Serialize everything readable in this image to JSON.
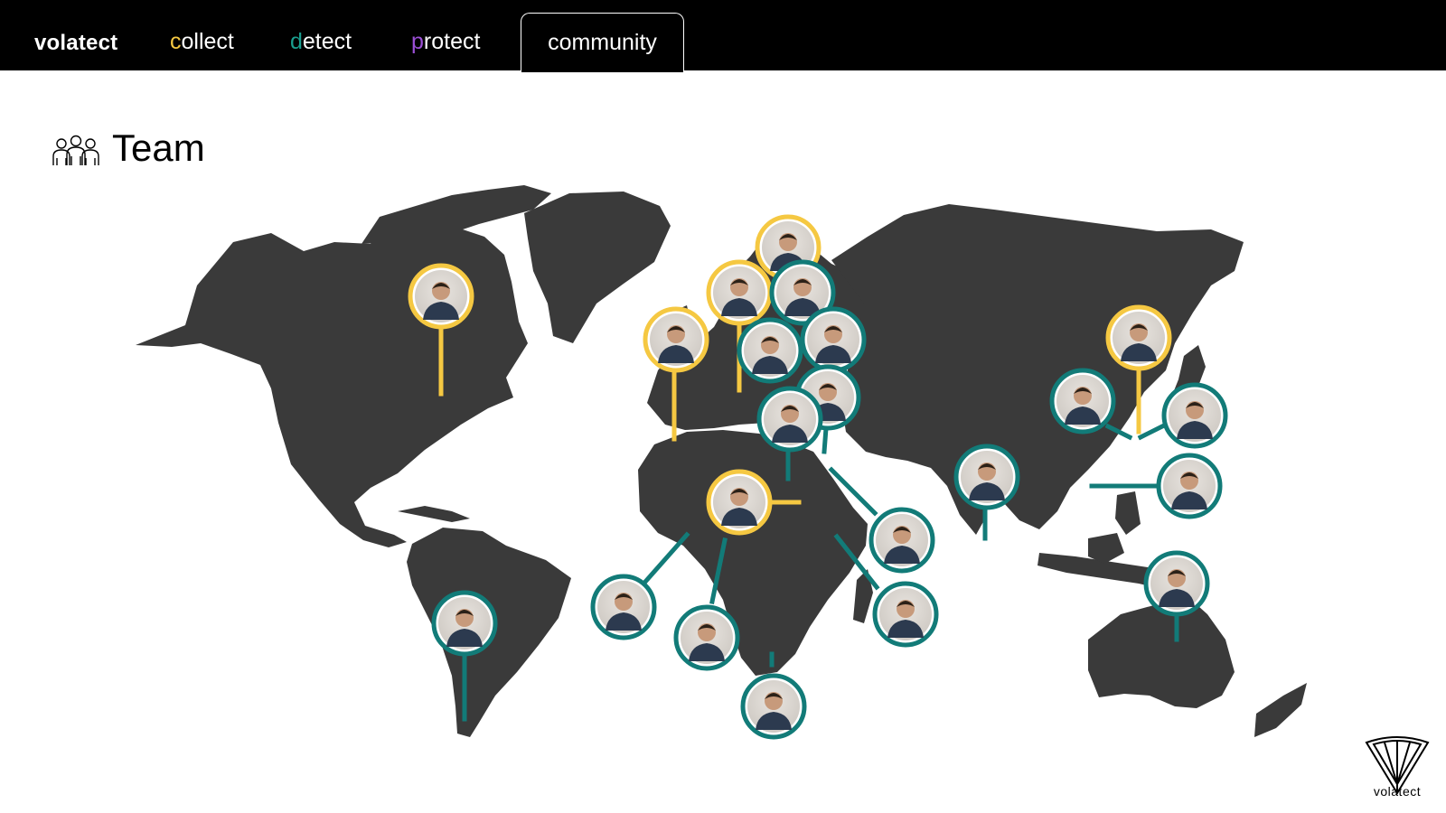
{
  "nav": {
    "brand": "volatect",
    "items": [
      {
        "first": "c",
        "rest": "ollect",
        "accent": "#f5c842"
      },
      {
        "first": "d",
        "rest": "etect",
        "accent": "#1a9e8f"
      },
      {
        "first": "p",
        "rest": "rotect",
        "accent": "#9b4fd6"
      }
    ],
    "active": "community"
  },
  "section": {
    "title": "Team",
    "icon": "team-people-icon"
  },
  "colors": {
    "land": "#3a3a3a",
    "gold": "#f5c842",
    "teal": "#127b78"
  },
  "logo": {
    "text": "volatect",
    "icon": "volatect-shield-logo"
  }
}
